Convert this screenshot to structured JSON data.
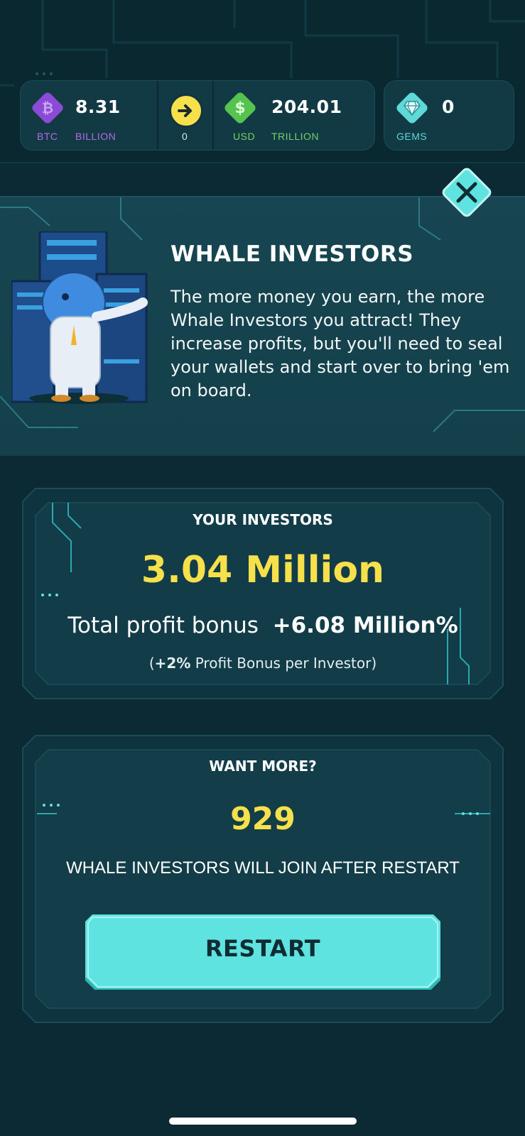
{
  "resources": {
    "btc": {
      "value": "8.31",
      "label": "BTC",
      "unit": "BILLION",
      "icon": "bitcoin-icon",
      "color": "#8c4bd6"
    },
    "boost": {
      "count": "0",
      "icon": "arrow-right-icon",
      "color": "#f6e04b"
    },
    "usd": {
      "value": "204.01",
      "label": "USD",
      "unit": "TRILLION",
      "icon": "dollar-icon",
      "color": "#56c24f"
    },
    "gems": {
      "value": "0",
      "label": "GEMS",
      "icon": "gem-icon",
      "color": "#5fd8d8"
    }
  },
  "banner": {
    "title": "WHALE INVESTORS",
    "text": "The more money you earn, the more Whale Investors you attract! They increase profits, but you'll need to seal your wallets and start over to bring 'em on board."
  },
  "investors_panel": {
    "title": "YOUR INVESTORS",
    "count": "3.04 Million",
    "profit_label": "Total profit bonus",
    "profit_value": "+6.08 Million%",
    "per_investor_prefix": "(",
    "per_investor_value": "+2%",
    "per_investor_suffix": " Profit Bonus per Investor)"
  },
  "restart_panel": {
    "title": "WANT MORE?",
    "count": "929",
    "caption": "WHALE INVESTORS WILL JOIN AFTER RESTART",
    "button_label": "RESTART"
  },
  "colors": {
    "background": "#0b2a33",
    "accent_cyan": "#5fe3e0",
    "accent_yellow": "#f6e04b",
    "btc_purple": "#8c4bd6",
    "usd_green": "#56c24f"
  }
}
